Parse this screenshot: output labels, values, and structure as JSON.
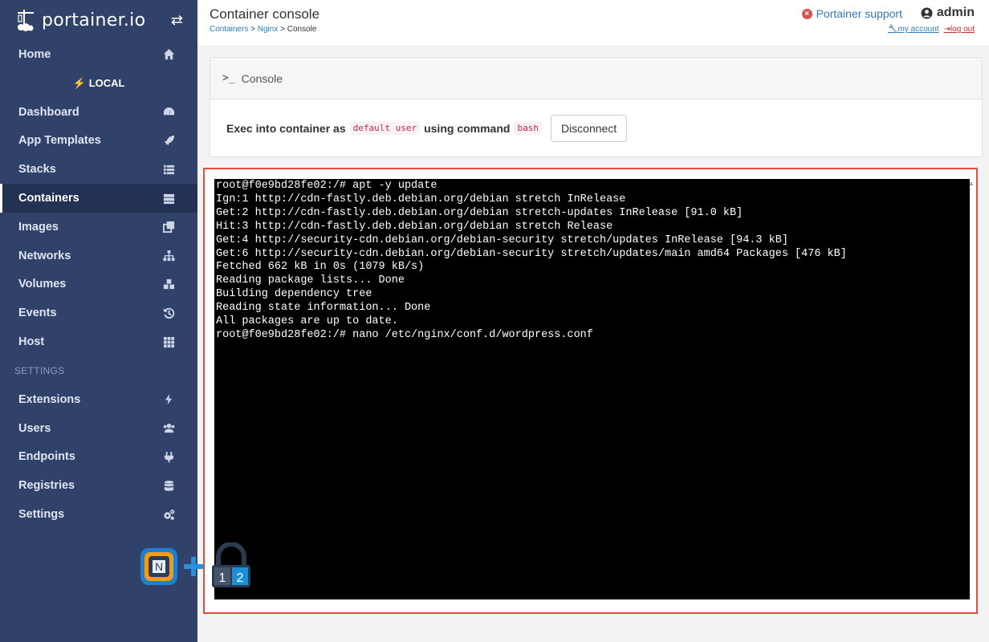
{
  "brand": {
    "name": "portainer.io"
  },
  "sidebar": {
    "home": "Home",
    "endpoint": "LOCAL",
    "items": [
      {
        "label": "Dashboard",
        "icon": "dashboard-icon"
      },
      {
        "label": "App Templates",
        "icon": "rocket-icon"
      },
      {
        "label": "Stacks",
        "icon": "list-icon"
      },
      {
        "label": "Containers",
        "icon": "server-icon"
      },
      {
        "label": "Images",
        "icon": "clone-icon"
      },
      {
        "label": "Networks",
        "icon": "sitemap-icon"
      },
      {
        "label": "Volumes",
        "icon": "cubes-icon"
      },
      {
        "label": "Events",
        "icon": "history-icon"
      },
      {
        "label": "Host",
        "icon": "th-icon"
      }
    ],
    "settings_title": "SETTINGS",
    "settings_items": [
      {
        "label": "Extensions",
        "icon": "bolt-icon"
      },
      {
        "label": "Users",
        "icon": "users-icon"
      },
      {
        "label": "Endpoints",
        "icon": "plug-icon"
      },
      {
        "label": "Registries",
        "icon": "database-icon"
      },
      {
        "label": "Settings",
        "icon": "cogs-icon"
      }
    ],
    "active": "Containers"
  },
  "header": {
    "title": "Container console",
    "breadcrumb": {
      "containers": "Containers",
      "sep": ">",
      "nginx": "Nginx",
      "console": "Console"
    },
    "support": "Portainer support",
    "user": "admin",
    "my_account": "my account",
    "log_out": "log out"
  },
  "console_panel": {
    "title": "Console",
    "exec_text": "Exec into container as",
    "user_code": "default user",
    "using_text": "using command",
    "command_code": "bash",
    "disconnect_label": "Disconnect"
  },
  "terminal": {
    "lines": [
      "root@f0e9bd28fe02:/# apt -y update",
      "Ign:1 http://cdn-fastly.deb.debian.org/debian stretch InRelease",
      "Get:2 http://cdn-fastly.deb.debian.org/debian stretch-updates InRelease [91.0 kB]",
      "Hit:3 http://cdn-fastly.deb.debian.org/debian stretch Release",
      "Get:4 http://security-cdn.debian.org/debian-security stretch/updates InRelease [94.3 kB]",
      "Get:6 http://security-cdn.debian.org/debian-security stretch/updates/main amd64 Packages [476 kB]",
      "Fetched 662 kB in 0s (1079 kB/s)",
      "Reading package lists... Done",
      "Building dependency tree",
      "Reading state information... Done",
      "All packages are up to date.",
      "root@f0e9bd28fe02:/# nano /etc/nginx/conf.d/wordpress.conf"
    ]
  },
  "watermark": {
    "digits": [
      "1",
      "2"
    ]
  },
  "colors": {
    "sidebar": "#30426a",
    "sidebar_active": "#223154",
    "link": "#337ab7",
    "highlight_border": "#e74c3c"
  }
}
